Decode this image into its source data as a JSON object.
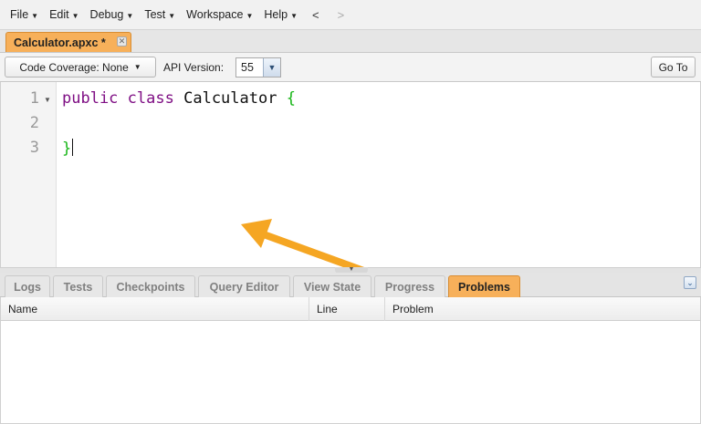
{
  "menu": {
    "items": [
      {
        "label": "File"
      },
      {
        "label": "Edit"
      },
      {
        "label": "Debug"
      },
      {
        "label": "Test"
      },
      {
        "label": "Workspace"
      },
      {
        "label": "Help"
      }
    ],
    "back_label": "<",
    "forward_label": ">"
  },
  "file_tab": {
    "label": "Calculator.apxc *",
    "close_icon": "close-icon",
    "color": "#f7b05a"
  },
  "toolbar": {
    "coverage_label": "Code Coverage: None",
    "api_version_label": "API Version:",
    "api_version_value": "55",
    "goto_label": "Go To"
  },
  "editor": {
    "line_numbers": [
      "1",
      "2",
      "3"
    ],
    "line1": {
      "kw1": "public",
      "kw2": "class",
      "name": "Calculator",
      "brace": "{"
    },
    "line3": {
      "brace": "}"
    },
    "keyword_color": "#7f0f84",
    "brace_color": "#16b516",
    "annotation_arrow_color": "#f5a623"
  },
  "panel_tabs": [
    {
      "label": "Logs",
      "active": false
    },
    {
      "label": "Tests",
      "active": false
    },
    {
      "label": "Checkpoints",
      "active": false
    },
    {
      "label": "Query Editor",
      "active": false
    },
    {
      "label": "View State",
      "active": false
    },
    {
      "label": "Progress",
      "active": false
    },
    {
      "label": "Problems",
      "active": true
    }
  ],
  "problems_table": {
    "columns": [
      "Name",
      "Line",
      "Problem"
    ],
    "rows": []
  }
}
